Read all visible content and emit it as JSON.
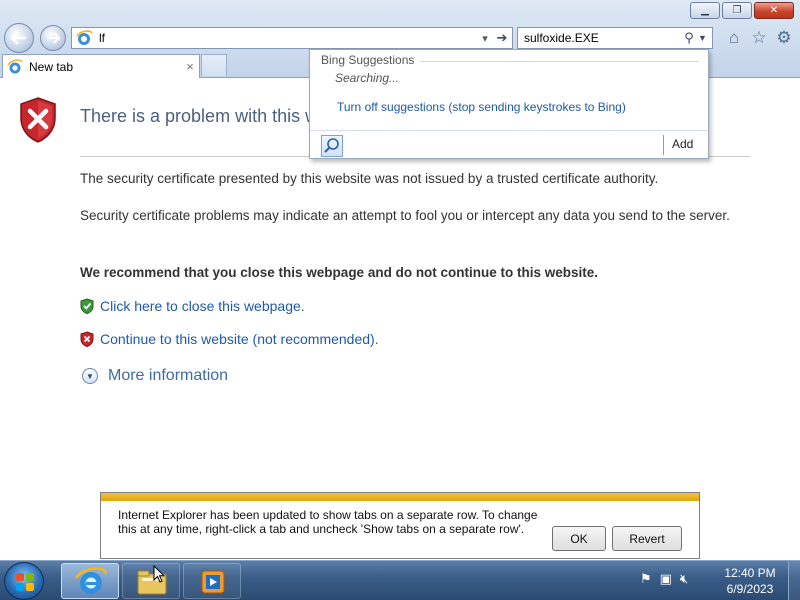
{
  "window": {
    "minimize_glyph": "▁",
    "restore_glyph": "❐",
    "close_glyph": "✕"
  },
  "address": {
    "value": "lf"
  },
  "search": {
    "value": "sulfoxide.EXE"
  },
  "tab": {
    "label": "New tab",
    "close_glyph": "×"
  },
  "suggestions": {
    "header": "Bing Suggestions",
    "status": "Searching...",
    "turn_off_link": "Turn off suggestions (stop sending keystrokes to Bing)",
    "add_label": "Add"
  },
  "content": {
    "title": "There is a problem with this w",
    "paragraph1": "The security certificate presented by this website was not issued by a trusted certificate authority.",
    "paragraph2": "Security certificate problems may indicate an attempt to fool you or intercept any data you send to the server.",
    "recommendation": "We recommend that you close this webpage and do not continue to this website.",
    "close_link": "Click here to close this webpage.",
    "continue_link": "Continue to this website (not recommended).",
    "more_info": "More information"
  },
  "notification": {
    "message": "Internet Explorer has been updated to show tabs on a separate row. To change this at any time, right-click a tab and uncheck 'Show tabs on a separate row'.",
    "ok_label": "OK",
    "revert_label": "Revert"
  },
  "taskbar": {
    "time": "12:40 PM",
    "date": "6/9/2023"
  },
  "colors": {
    "link": "#1f5aa8",
    "title": "#4c607e",
    "error_red": "#c8262c",
    "ok_green": "#3a9b3a",
    "notification_stripe": "#e1a70f"
  },
  "icons": {
    "back": "back-arrow-icon",
    "forward": "forward-arrow-icon",
    "home": "home-icon",
    "favorites": "star-icon",
    "tools": "gear-icon"
  }
}
